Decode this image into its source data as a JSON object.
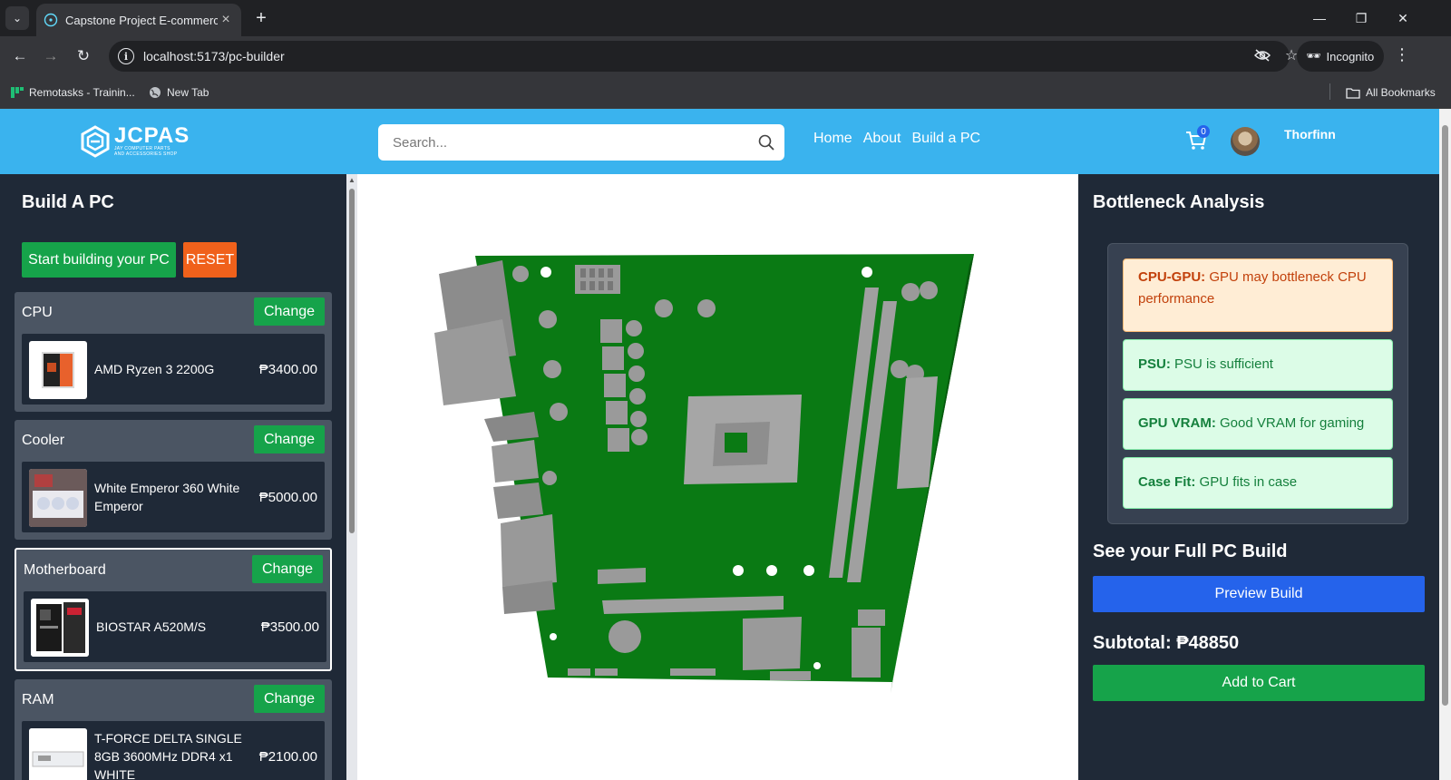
{
  "browser": {
    "tab_title": "Capstone Project E-commerce",
    "url": "localhost:5173/pc-builder",
    "profile_label": "Incognito",
    "bookmarks": [
      {
        "label": "Remotasks - Trainin...",
        "icon": "remotasks-icon"
      },
      {
        "label": "New Tab",
        "icon": "globe-icon"
      }
    ],
    "all_bookmarks_label": "All Bookmarks"
  },
  "header": {
    "logo_text": "JCPAS",
    "logo_subtext": "JAY COMPUTER PARTS AND ACCESSORIES SHOP",
    "search_placeholder": "Search...",
    "nav": [
      "Home",
      "About",
      "Build a PC"
    ],
    "cart_count": "0",
    "username": "Thorfinn"
  },
  "builder": {
    "title": "Build A PC",
    "start_label": "Start building your PC",
    "reset_label": "RESET",
    "change_label": "Change",
    "components": [
      {
        "category": "CPU",
        "name": "AMD Ryzen 3 2200G",
        "price": "₱3400.00"
      },
      {
        "category": "Cooler",
        "name": "White Emperor 360 White Emperor",
        "price": "₱5000.00"
      },
      {
        "category": "Motherboard",
        "name": "BIOSTAR A520M/S",
        "price": "₱3500.00",
        "selected": true
      },
      {
        "category": "RAM",
        "name": "T-FORCE DELTA SINGLE 8GB 3600MHz DDR4 x1 WHITE",
        "price": "₱2100.00"
      }
    ]
  },
  "analysis": {
    "title": "Bottleneck Analysis",
    "notes": [
      {
        "label": "CPU-GPU:",
        "text": "GPU may bottleneck CPU performance",
        "status": "warning"
      },
      {
        "label": "PSU:",
        "text": "PSU is sufficient",
        "status": "ok"
      },
      {
        "label": "GPU VRAM:",
        "text": "Good VRAM for gaming",
        "status": "ok"
      },
      {
        "label": "Case Fit:",
        "text": "GPU fits in case",
        "status": "ok"
      }
    ],
    "full_build_title": "See your Full PC Build",
    "preview_label": "Preview Build",
    "subtotal": "Subtotal: ₱48850",
    "add_to_cart_label": "Add to Cart"
  },
  "colors": {
    "header_bg": "#3ab3ee",
    "panel_bg": "#1f2937",
    "green": "#16a34a",
    "orange": "#f0611b",
    "blue": "#2563eb",
    "pcb_green": "#0a7a14"
  }
}
